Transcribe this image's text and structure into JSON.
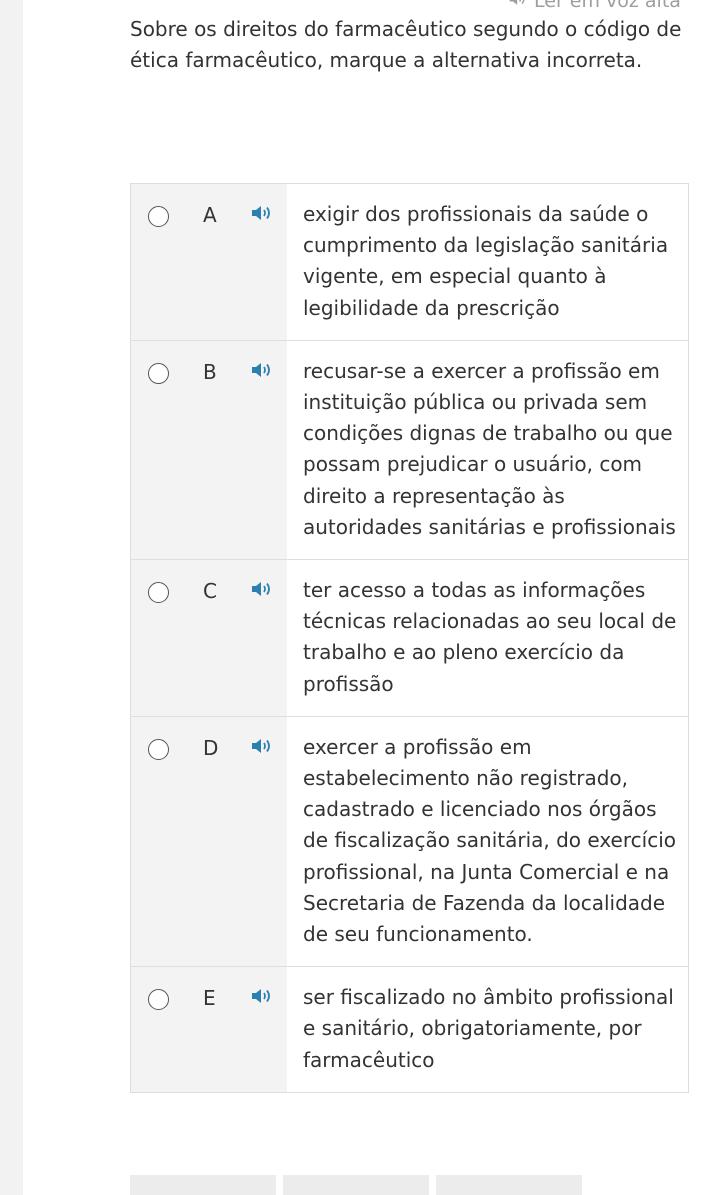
{
  "tts": {
    "read_aloud_label": "Ler em voz alta"
  },
  "question": {
    "text": "Sobre os direitos do farmacêutico segundo o código de ética farmacêutico, marque a alternativa incorreta."
  },
  "options": [
    {
      "letter": "A",
      "text": "exigir dos profissionais da saúde o cumprimento da legislação sanitária vigente, em especial quanto à legibilidade da prescrição"
    },
    {
      "letter": "B",
      "text": "recusar-se a exercer a profissão em instituição pública ou privada sem condições dignas de trabalho ou que possam prejudicar o usuário, com direito a representação às autoridades sanitárias e profissionais"
    },
    {
      "letter": "C",
      "text": "ter acesso a todas as informações técnicas relacionadas ao seu local de trabalho e ao pleno exercício da profissão"
    },
    {
      "letter": "D",
      "text": "exercer a profissão em estabelecimento não registrado, cadastrado e licenciado nos órgãos de fiscalização sanitária, do exercício profissional, na Junta Comercial e na Secretaria de Fazenda da localidade de seu funcionamento."
    },
    {
      "letter": "E",
      "text": "ser fiscalizado no âmbito profissional e sanitário, obrigatoriamente, por farmacêutico"
    }
  ],
  "colors": {
    "speaker_icon": "#2b7fb1",
    "rail": "#f2f2f2",
    "option_left_bg": "#f3f3f3"
  }
}
